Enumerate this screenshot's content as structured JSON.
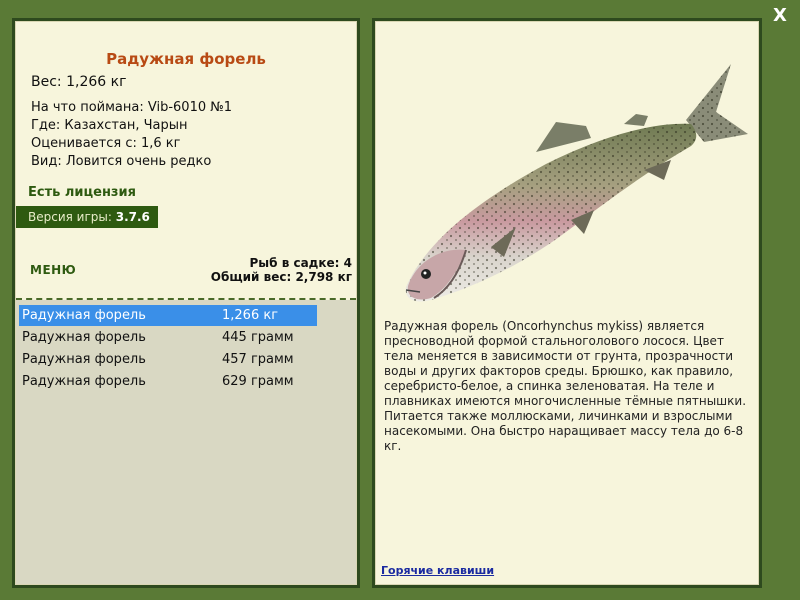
{
  "close_label": "X",
  "fish": {
    "title": "Радужная форель",
    "weight": "Вес: 1,266 кг",
    "caught_with": "На что поймана: Vib-6010 №1",
    "location": "Где: Казахстан, Чарын",
    "valued_from": "Оценивается с: 1,6 кг",
    "rarity": "Вид: Ловится очень редко"
  },
  "license": "Есть лицензия",
  "version": {
    "label": "Версия игры: ",
    "value": "3.7.6"
  },
  "menu_label": "МЕНЮ",
  "stats": {
    "count": "Рыб в садке: 4",
    "total": "Общий вес: 2,798 кг"
  },
  "catch_list": [
    {
      "name": "Радужная форель",
      "weight": "1,266 кг",
      "selected": true
    },
    {
      "name": "Радужная форель",
      "weight": "445 грамм",
      "selected": false
    },
    {
      "name": "Радужная форель",
      "weight": "457 грамм",
      "selected": false
    },
    {
      "name": "Радужная форель",
      "weight": "629 грамм",
      "selected": false
    }
  ],
  "description": "Радужная форель (Oncorhynchus mykiss) является пресноводной формой стальноголового лосося. Цвет тела меняется в зависимости от грунта, прозрачности воды и других факторов среды. Брюшко, как правило, серебристо-белое, а спинка зеленоватая. На теле и плавниках имеются многочисленные тёмные пятнышки. Питается также моллюсками, личинками и взрослыми насекомыми. Она быстро наращивает массу тела до 6-8 кг.",
  "hotkeys_label": "Горячие клавиши",
  "colors": {
    "frame": "#5a7a36",
    "panel": "#f7f5dc",
    "accent_title": "#b84a14",
    "selection": "#3a8fe8"
  }
}
